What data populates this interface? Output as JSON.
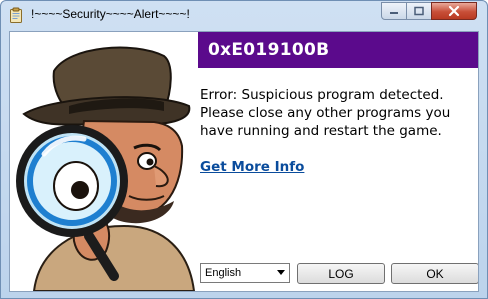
{
  "window": {
    "title": "!~~~~Security~~~~Alert~~~~!",
    "controls": [
      "minimize-icon",
      "maximize-icon",
      "close-icon"
    ]
  },
  "alert": {
    "code": "0xE019100B",
    "message_lines": [
      "Error: Suspicious program detected.",
      "Please close any other programs you",
      "have running and restart the game."
    ],
    "more_info_link": "Get More Info",
    "colors": {
      "header": "#5b0a8c",
      "link": "#0a4c9c"
    }
  },
  "footer": {
    "language_selected": "English",
    "log_button": "LOG",
    "ok_button": "OK"
  },
  "illustration": {
    "icon": "detective-with-magnifier-icon"
  }
}
